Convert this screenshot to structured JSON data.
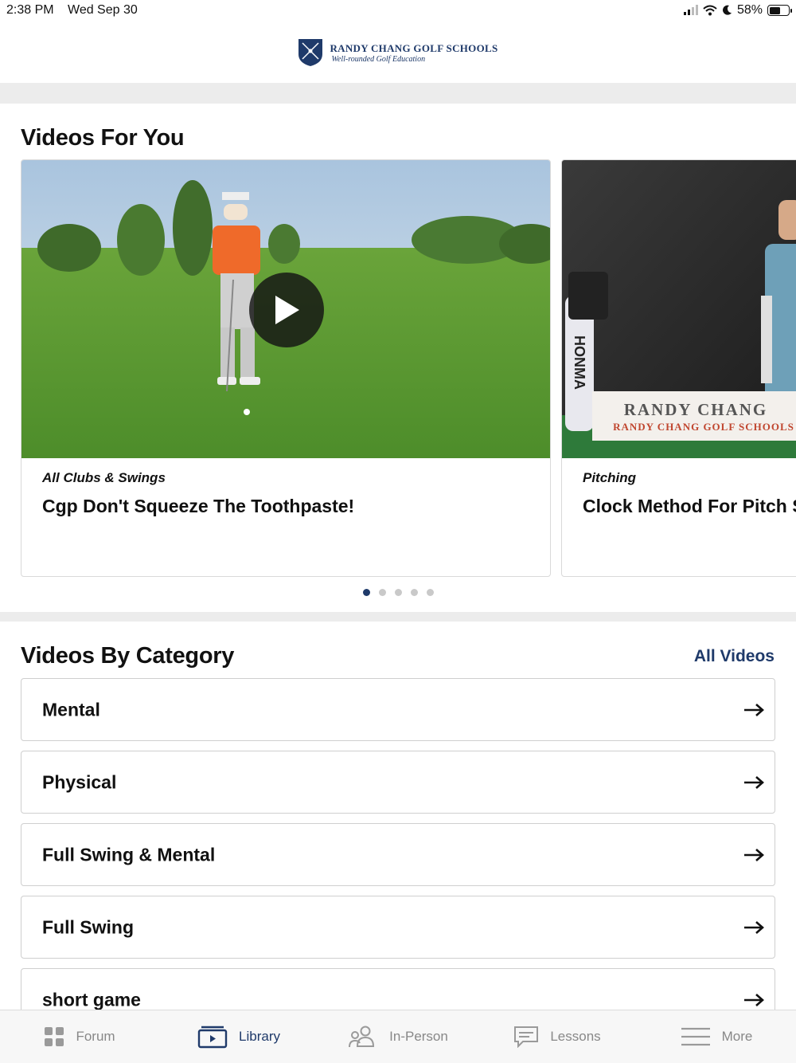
{
  "status_bar": {
    "time": "2:38 PM",
    "date": "Wed Sep 30",
    "battery": "58%",
    "battery_level": 0.58
  },
  "header": {
    "logo_name": "RANDY CHANG GOLF SCHOOLS",
    "logo_tagline": "Well-rounded Golf Education"
  },
  "videos_for_you": {
    "title": "Videos For You",
    "cards": [
      {
        "category": "All Clubs & Swings",
        "title": "Cgp  Don't Squeeze The Toothpaste!"
      },
      {
        "category": "Pitching",
        "title": "Clock Method For Pitch S",
        "banner_name": "RANDY CHANG",
        "banner_sub": "RANDY CHANG GOLF SCHOOLS",
        "bag_brand": "HONMA"
      }
    ],
    "page_count": 5,
    "active_page": 1
  },
  "videos_by_category": {
    "title": "Videos By Category",
    "all_videos_label": "All Videos",
    "categories": [
      {
        "label": "Mental"
      },
      {
        "label": "Physical"
      },
      {
        "label": "Full Swing & Mental"
      },
      {
        "label": "Full Swing"
      },
      {
        "label": "short game"
      }
    ]
  },
  "tab_bar": {
    "tabs": [
      {
        "label": "Forum",
        "icon": "grid-icon"
      },
      {
        "label": "Library",
        "icon": "video-library-icon"
      },
      {
        "label": "In-Person",
        "icon": "people-icon"
      },
      {
        "label": "Lessons",
        "icon": "chat-icon"
      },
      {
        "label": "More",
        "icon": "menu-icon"
      }
    ],
    "active": "Library"
  },
  "colors": {
    "brand_navy": "#1f3a6a",
    "divider": "#ececec",
    "inactive_tab": "#888888"
  }
}
